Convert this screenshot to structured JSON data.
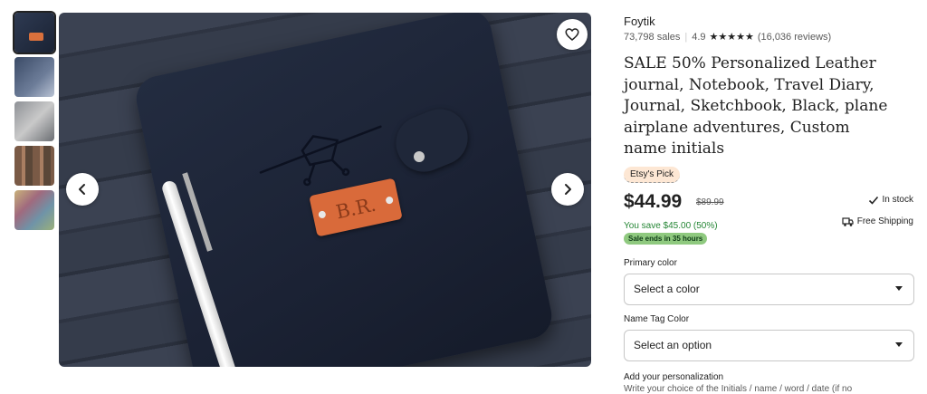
{
  "shop": {
    "name": "Foytik",
    "sales": "73,798 sales",
    "rating": "4.9",
    "stars": "★★★★★",
    "reviews": "(16,036 reviews)"
  },
  "product": {
    "title": "SALE 50% Personalized Leather journal, Notebook, Travel Diary, Journal, Sketchbook, Black, plane airplane adventures, Custom name initials",
    "badge": "Etsy's Pick",
    "price": "$44.99",
    "original_price": "$89.99",
    "savings": "You save $45.00 (50%)",
    "sale_ends": "Sale ends in 35 hours",
    "stock_status": "In stock",
    "shipping": "Free Shipping",
    "name_tag_initials": "B.R."
  },
  "options": {
    "primary_color_label": "Primary color",
    "primary_color_value": "Select a color",
    "name_tag_label": "Name Tag Color",
    "name_tag_value": "Select an option"
  },
  "personalization": {
    "label": "Add your personalization",
    "hint": "Write your choice of the Initials / name / word / date (if no"
  },
  "gallery": {
    "thumbnail_count": 5,
    "active_index": 0
  },
  "colors": {
    "sale_green": "#258635",
    "badge_green": "#8fc97f",
    "pick_bg": "#fde7d4",
    "tag_orange": "#d96a3a"
  },
  "icons": {
    "prev": "chevron-left-icon",
    "next": "chevron-right-icon",
    "favorite": "heart-icon",
    "stock": "checkmark-icon",
    "shipping": "truck-icon",
    "dropdown": "caret-down-icon"
  }
}
